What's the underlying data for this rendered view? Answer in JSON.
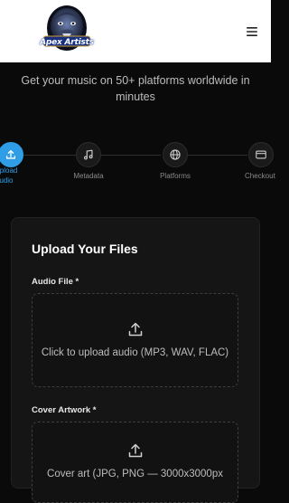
{
  "header": {
    "logo_text": "Apex Artists",
    "menu_icon": "hamburger-menu-icon"
  },
  "subtitle": {
    "line1": "Get your music on 50+ platforms worldwide in",
    "line2": "minutes"
  },
  "steps": [
    {
      "label_line1": "Upload",
      "label_line2": "Audio",
      "icon": "upload-icon",
      "active": true
    },
    {
      "label": "Metadata",
      "icon": "music-note-icon",
      "active": false
    },
    {
      "label": "Platforms",
      "icon": "globe-icon",
      "active": false
    },
    {
      "label": "Checkout",
      "icon": "credit-card-icon",
      "active": false
    }
  ],
  "upload": {
    "title": "Upload Your Files",
    "audio_label": "Audio File *",
    "audio_prompt": "Click to upload audio (MP3, WAV, FLAC)",
    "cover_label": "Cover Artwork *",
    "cover_prompt": "Cover art (JPG, PNG — 3000x3000px"
  },
  "colors": {
    "accent": "#2f9ee6",
    "background": "#0a0a0a",
    "card": "#151515"
  }
}
